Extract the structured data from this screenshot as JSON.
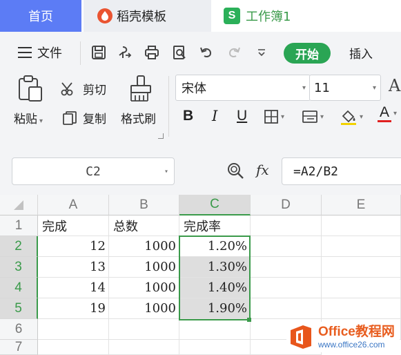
{
  "tabs": [
    {
      "label": "首页"
    },
    {
      "label": "稻壳模板"
    },
    {
      "label": "工作簿1",
      "icon_letter": "S"
    }
  ],
  "menu": {
    "file_label": "文件",
    "start_label": "开始",
    "insert_label": "插入"
  },
  "ribbon": {
    "paste_label": "粘贴",
    "cut_label": "剪切",
    "copy_label": "复制",
    "format_painter_label": "格式刷",
    "font_name": "宋体",
    "font_size": "11",
    "bold_label": "B",
    "italic_label": "I",
    "underline_label": "U",
    "font_color_label": "A",
    "font_color": "#e02020",
    "partial_label": "A"
  },
  "formula_bar": {
    "name_box": "C2",
    "fx_label": "fx",
    "formula": "=A2/B2"
  },
  "sheet": {
    "columns": [
      "A",
      "B",
      "C",
      "D",
      "E"
    ],
    "rows": [
      "1",
      "2",
      "3",
      "4",
      "5",
      "6",
      "7"
    ],
    "cells": {
      "A1": "完成",
      "B1": "总数",
      "C1": "完成率",
      "A2": "12",
      "B2": "1000",
      "C2": "1.20%",
      "A3": "13",
      "B3": "1000",
      "C3": "1.30%",
      "A4": "14",
      "B4": "1000",
      "C4": "1.40%",
      "A5": "19",
      "B5": "1000",
      "C5": "1.90%"
    },
    "selected_range": "C2:C5",
    "accent_color": "#3a9a4a"
  },
  "watermark": {
    "title": "Office教程网",
    "url": "www.office26.com"
  }
}
